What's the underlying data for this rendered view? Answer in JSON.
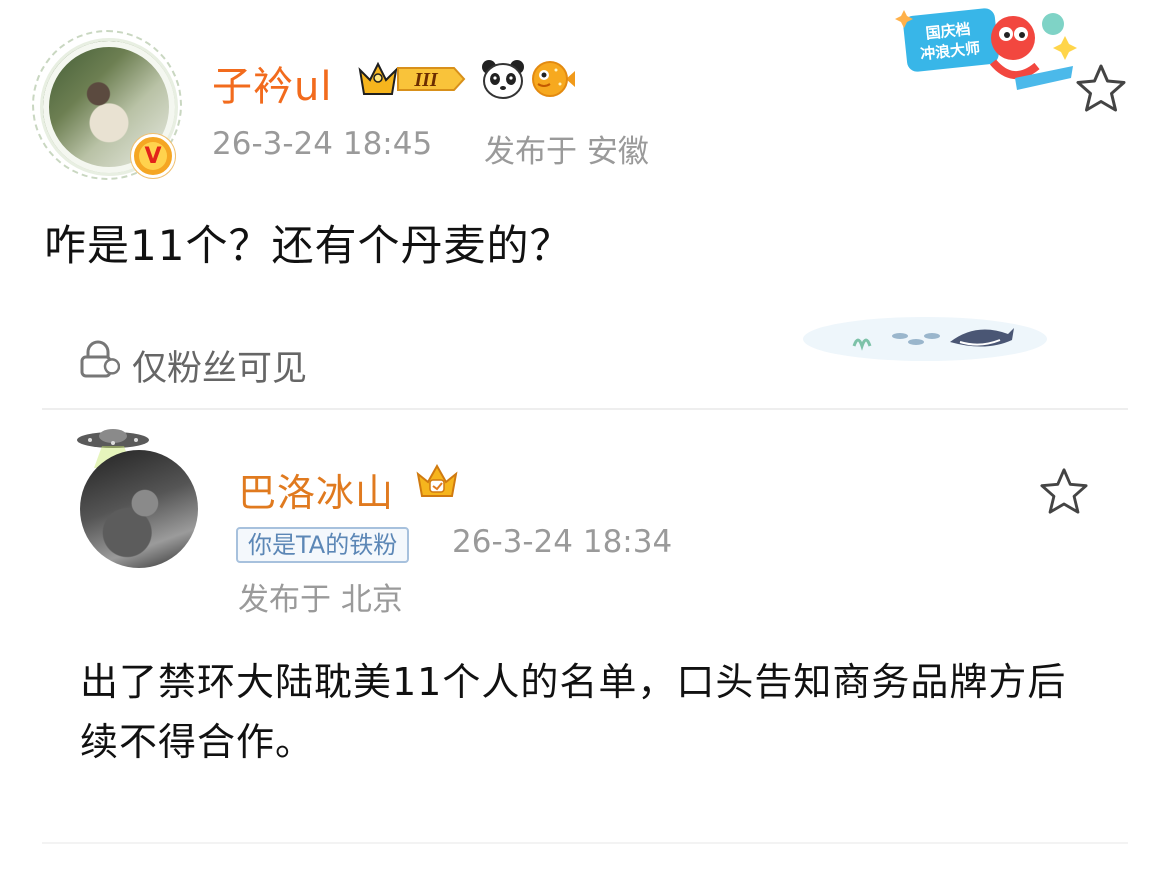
{
  "post": {
    "author": "子衿ul",
    "level_badge": "III",
    "time": "26-3-24 18:45",
    "location": "发布于 安徽",
    "content": "咋是11个？还有个丹麦的？",
    "visibility": "仅粉丝可见",
    "promo_badge_lines": [
      "国庆档",
      "冲浪大师"
    ]
  },
  "quoted": {
    "author": "巴洛冰山",
    "fan_badge": "你是TA的铁粉",
    "time": "26-3-24 18:34",
    "location": "发布于 北京",
    "content": "出了禁环大陆耽美11个人的名单，口头告知商务品牌方后续不得合作。"
  },
  "colors": {
    "author_main": "#f26b1d",
    "author_reply": "#e07a1f",
    "meta": "#9a9a9a",
    "fan_badge": "#5c87b6"
  },
  "icons": [
    "verified-v-icon",
    "crown-level-icon",
    "panda-icon",
    "pufferfish-icon",
    "star-icon",
    "lock-icon",
    "ufo-icon",
    "crown-small-icon"
  ]
}
